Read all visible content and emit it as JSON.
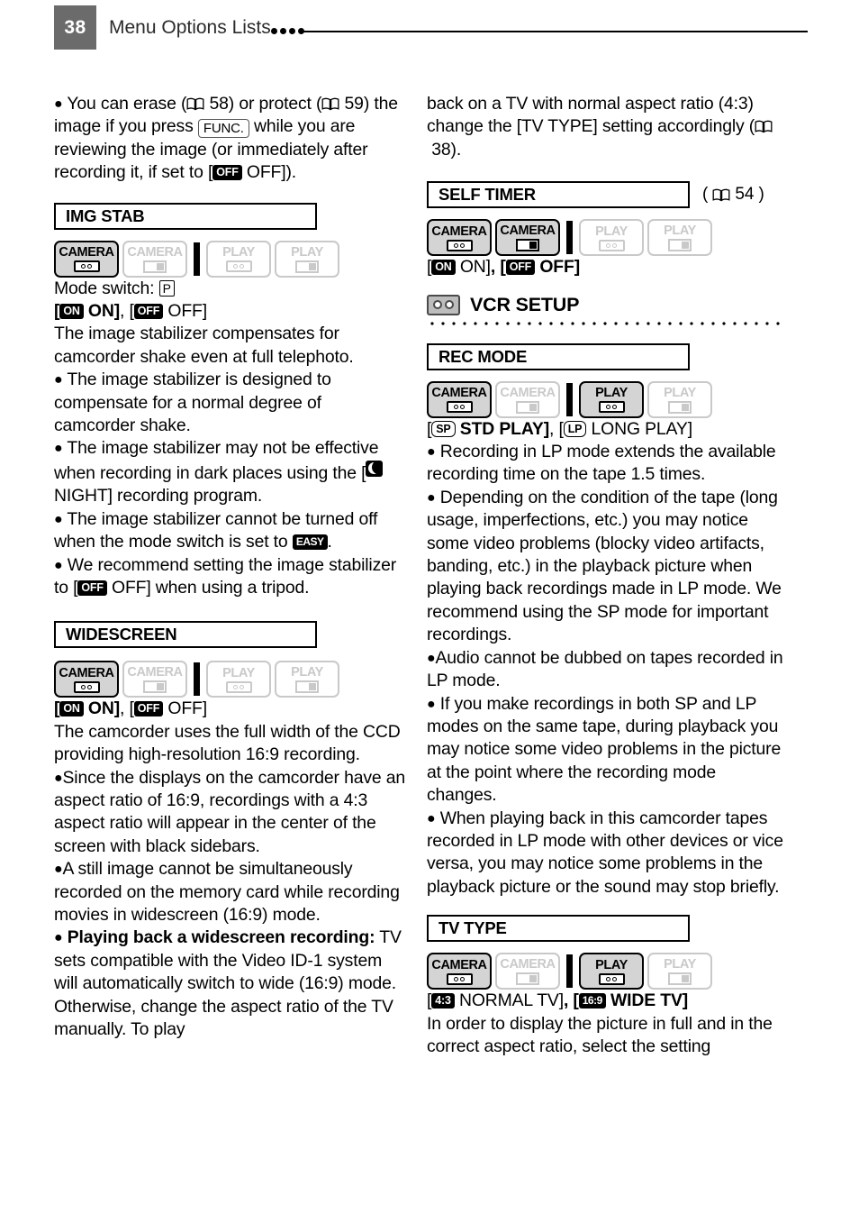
{
  "header": {
    "page_number": "38",
    "title": "Menu Options Lists",
    "dot_count": 4
  },
  "left_column": {
    "intro_bullet": {
      "bullet": "●",
      "part1": "You can erase (",
      "ref1": "58",
      "part2": ") or protect (",
      "ref2": "59",
      "part3": ") the image if you press",
      "key": "FUNC.",
      "part4": "while you are reviewing the image (or immediately after recording it, if set to [",
      "badge_off": "OFF",
      "part5": "OFF])."
    },
    "img_stab": {
      "title": "IMG STAB",
      "modes": [
        {
          "label": "CAMERA",
          "glyph": "tape-glyph",
          "active": true
        },
        {
          "label": "CAMERA",
          "glyph": "card-glyph",
          "active": false
        },
        {
          "label": "PLAY",
          "glyph": "tape-glyph",
          "active": false
        },
        {
          "label": "PLAY",
          "glyph": "card-glyph",
          "active": false
        }
      ],
      "mode_switch_label": "Mode switch:",
      "mode_switch_key": "P",
      "options": {
        "on_badge": "ON",
        "on_label": "ON",
        "off_badge": "OFF",
        "off_label": "OFF"
      },
      "desc": "The image stabilizer compensates for camcorder shake even at full telephoto.",
      "bullets": [
        {
          "text": "The image stabilizer is designed to compensate for a normal degree of camcorder shake."
        },
        {
          "pre": "The image stabilizer may not be effective when recording in dark places using the [",
          "badge": "night-icon",
          "post": "NIGHT] recording program."
        },
        {
          "pre": "The image stabilizer cannot be turned off when the mode switch is set to",
          "badge": "EASY",
          "post": "."
        },
        {
          "pre": "We recommend setting the image stabilizer to [",
          "badge": "OFF",
          "post": "OFF] when using a tripod."
        }
      ]
    },
    "widescreen": {
      "title": "WIDESCREEN",
      "modes": [
        {
          "label": "CAMERA",
          "glyph": "tape-glyph",
          "active": true
        },
        {
          "label": "CAMERA",
          "glyph": "card-glyph",
          "active": false
        },
        {
          "label": "PLAY",
          "glyph": "tape-glyph",
          "active": false
        },
        {
          "label": "PLAY",
          "glyph": "card-glyph",
          "active": false
        }
      ],
      "options": {
        "on_badge": "ON",
        "on_label": "ON",
        "off_badge": "OFF",
        "off_label": "OFF"
      },
      "desc": "The camcorder uses the full width of the CCD providing high-resolution 16:9 recording.",
      "bullets": [
        {
          "text": "Since the displays on the camcorder have an aspect ratio of 16:9, recordings with a 4:3 aspect ratio will appear in the center of the screen with black sidebars."
        },
        {
          "text": "A still image cannot be simultaneously recorded on the memory card while recording movies in widescreen (16:9) mode."
        },
        {
          "bold_lead": "Playing back a widescreen recording:",
          "text": "TV sets compatible with the Video ID-1 system will automatically switch to wide (16:9) mode. Otherwise, change the aspect ratio of the TV manually. To play"
        }
      ]
    }
  },
  "right_column": {
    "continuation": "back on a TV with normal aspect ratio (4:3) change the [TV TYPE] setting accordingly (",
    "continuation_ref": "38",
    "continuation_end": ").",
    "self_timer": {
      "title": "SELF TIMER",
      "ref": "54",
      "modes": [
        {
          "label": "CAMERA",
          "glyph": "tape-glyph",
          "active": true
        },
        {
          "label": "CAMERA",
          "glyph": "card-glyph",
          "active": true
        },
        {
          "label": "PLAY",
          "glyph": "tape-glyph",
          "active": false
        },
        {
          "label": "PLAY",
          "glyph": "card-glyph",
          "active": false
        }
      ],
      "options": {
        "on_badge": "ON",
        "on_label": "ON",
        "off_badge": "OFF",
        "off_label": "OFF"
      }
    },
    "vcr_setup": {
      "group_title": "VCR SETUP",
      "group_icon": "tape-cassette-icon"
    },
    "rec_mode": {
      "title": "REC MODE",
      "modes": [
        {
          "label": "CAMERA",
          "glyph": "tape-glyph",
          "active": true
        },
        {
          "label": "CAMERA",
          "glyph": "card-glyph",
          "active": false
        },
        {
          "label": "PLAY",
          "glyph": "tape-glyph",
          "active": true
        },
        {
          "label": "PLAY",
          "glyph": "card-glyph",
          "active": false
        }
      ],
      "options": {
        "std_badge": "SP",
        "std_label": "STD PLAY",
        "long_badge": "LP",
        "long_label": "LONG PLAY"
      },
      "bullets": [
        {
          "text": "Recording in LP mode extends the available recording time on the tape 1.5 times."
        },
        {
          "text": "Depending on the condition of the tape (long usage, imperfections, etc.) you may notice some video problems (blocky video artifacts, banding, etc.) in the playback picture when playing back recordings made in LP mode. We recommend using the SP mode for important recordings."
        },
        {
          "text": "Audio cannot be dubbed on tapes recorded in LP mode."
        },
        {
          "text": "If you make recordings in both SP and LP modes on the same tape, during playback you may notice some video problems in the picture at the point where the recording mode changes."
        },
        {
          "text": "When playing back in this camcorder tapes recorded in LP mode with other devices or vice versa, you may notice some problems in the playback picture or the sound may stop briefly."
        }
      ]
    },
    "tv_type": {
      "title": "TV TYPE",
      "modes": [
        {
          "label": "CAMERA",
          "glyph": "tape-glyph",
          "active": true
        },
        {
          "label": "CAMERA",
          "glyph": "card-glyph",
          "active": false
        },
        {
          "label": "PLAY",
          "glyph": "tape-glyph",
          "active": true
        },
        {
          "label": "PLAY",
          "glyph": "card-glyph",
          "active": false
        }
      ],
      "options": {
        "normal_badge": "4:3",
        "normal_label": "NORMAL TV",
        "wide_badge": "16:9",
        "wide_label": "WIDE TV"
      },
      "desc": "In order to display the picture in full and in the correct aspect ratio, select the setting"
    }
  },
  "colors": {
    "page_number_bg": "#6b6b6b",
    "mode_active_bg": "#d4d4d4",
    "mode_inactive_fg": "#c9c9c9",
    "text": "#000000"
  }
}
